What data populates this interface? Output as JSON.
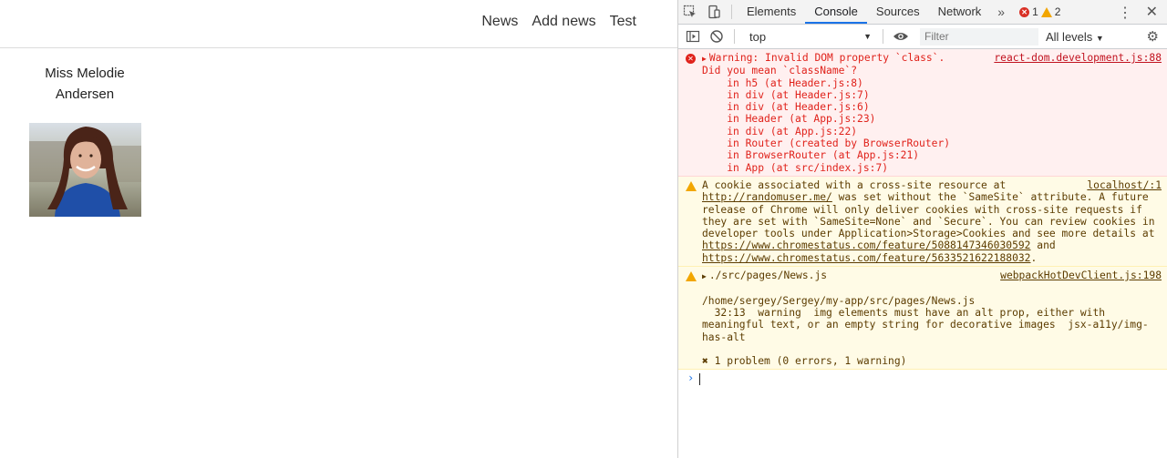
{
  "nav": {
    "items": [
      "News",
      "Add news",
      "Test"
    ]
  },
  "user": {
    "name_line1": "Miss Melodie",
    "name_line2": "Andersen"
  },
  "devtools": {
    "tabs": [
      "Elements",
      "Console",
      "Sources",
      "Network"
    ],
    "active_tab": "Console",
    "more": "»",
    "error_count": "1",
    "warning_count": "2",
    "context": "top",
    "filter_placeholder": "Filter",
    "levels": "All levels",
    "messages": {
      "error": {
        "source": "react-dom.development.js:88",
        "lines": [
          "Warning: Invalid DOM property `class`.",
          "Did you mean `className`?",
          "    in h5 (at Header.js:8)",
          "    in div (at Header.js:7)",
          "    in div (at Header.js:6)",
          "    in Header (at App.js:23)",
          "    in div (at App.js:22)",
          "    in Router (created by BrowserRouter)",
          "    in BrowserRouter (at App.js:21)",
          "    in App (at src/index.js:7)"
        ]
      },
      "cookie": {
        "source": "localhost/:1",
        "text_a": "A cookie associated with a cross-site resource at ",
        "link_a": "http://randomuser.me/",
        "text_b": " was set without the `SameSite` attribute. A future release of Chrome will only deliver cookies with cross-site requests if they are set with `SameSite=None` and `Secure`. You can review cookies in developer tools under Application>Storage>Cookies and see more details at ",
        "link_b": "https://www.chromestatus.com/feature/5088147346030592",
        "text_c": " and ",
        "link_c": "https://www.chromestatus.com/feature/5633521622188032",
        "text_d": "."
      },
      "webpack": {
        "title": "./src/pages/News.js",
        "source": "webpackHotDevClient.js:198",
        "path": "/home/sergey/Sergey/my-app/src/pages/News.js",
        "detail": "  32:13  warning  img elements must have an alt prop, either with meaningful text, or an empty string for decorative images  jsx-a11y/img-has-alt",
        "summary": "✖ 1 problem (0 errors, 1 warning)"
      }
    },
    "prompt": "›"
  }
}
